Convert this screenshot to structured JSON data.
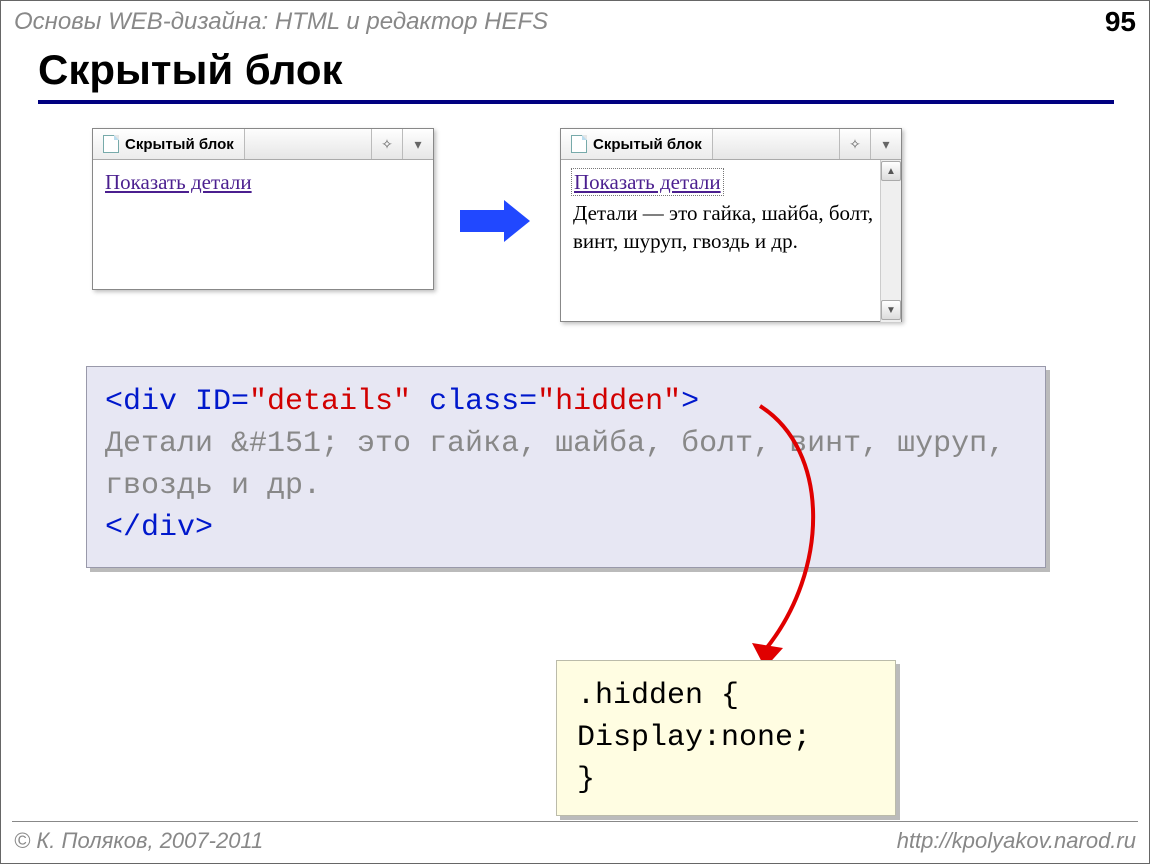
{
  "header": {
    "breadcrumb": "Основы WEB-дизайна: HTML и редактор HEFS",
    "page_number": "95",
    "title": "Скрытый блок"
  },
  "browser1": {
    "tab_title": "Скрытый блок",
    "link_text": "Показать детали"
  },
  "browser2": {
    "tab_title": "Скрытый блок",
    "link_text": "Показать детали",
    "details": "Детали — это гайка, шайба, болт, винт, шуруп, гвоздь и др."
  },
  "code": {
    "open_tag_left": "<div ",
    "attr_id_name": "ID=",
    "attr_id_val": "\"details\"",
    "attr_class_name": " class=",
    "attr_class_val": "\"hidden\"",
    "open_tag_right": ">",
    "body": "Детали &#151; это гайка, шайба, болт, винт, шуруп, гвоздь и др.",
    "close_tag": "</div>"
  },
  "css": {
    "line1": ".hidden {",
    "line2": " Display:none;",
    "line3": "}"
  },
  "footer": {
    "left": "© К. Поляков, 2007-2011",
    "right": "http://kpolyakov.narod.ru"
  }
}
